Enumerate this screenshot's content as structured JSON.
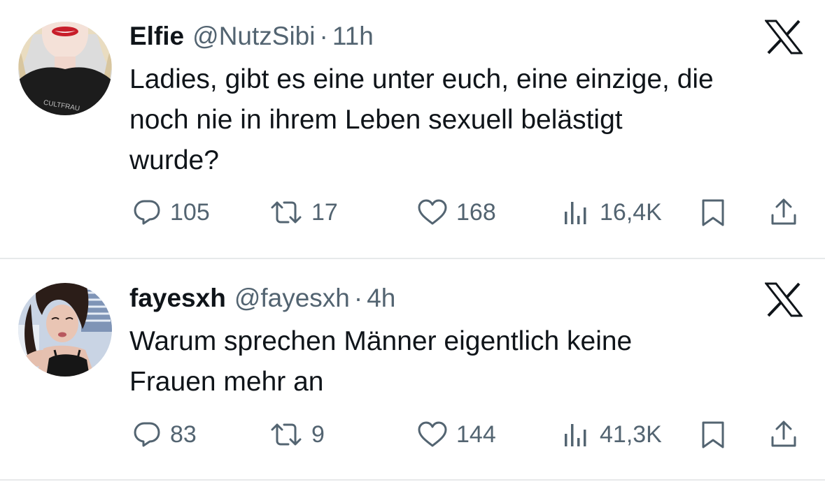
{
  "colors": {
    "text_primary": "#0f1419",
    "text_secondary": "#536471",
    "divider": "#e7e9ea",
    "background": "#ffffff"
  },
  "tweets": [
    {
      "display_name": "Elfie",
      "handle": "@NutzSibi",
      "separator": "·",
      "time": "11h",
      "text": "Ladies, gibt es eine unter euch, eine einzige, die\nnoch nie in ihrem Leben sexuell belästigt\nwurde?",
      "avatar_caption": "CULTFRAU",
      "counts": {
        "replies": "105",
        "reposts": "17",
        "likes": "168",
        "views": "16,4K"
      },
      "icons": [
        "x-logo-icon",
        "reply-icon",
        "repost-icon",
        "like-icon",
        "views-icon",
        "bookmark-icon",
        "share-icon"
      ]
    },
    {
      "display_name": "fayesxh",
      "handle": "@fayesxh",
      "separator": "·",
      "time": "4h",
      "text": "Warum sprechen Männer eigentlich keine\nFrauen mehr an",
      "counts": {
        "replies": "83",
        "reposts": "9",
        "likes": "144",
        "views": "41,3K"
      },
      "icons": [
        "x-logo-icon",
        "reply-icon",
        "repost-icon",
        "like-icon",
        "views-icon",
        "bookmark-icon",
        "share-icon"
      ]
    }
  ]
}
